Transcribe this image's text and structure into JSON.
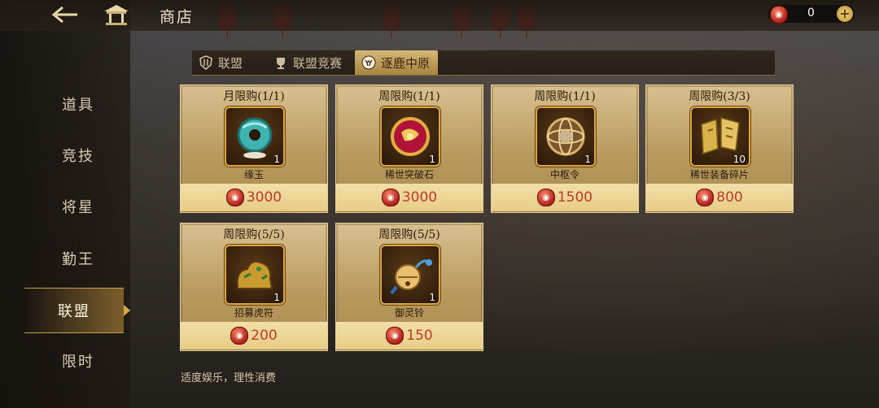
{
  "header": {
    "title": "商店",
    "currency_amount": "0",
    "plus_label": "+"
  },
  "sidebar": {
    "items": [
      {
        "label": "道具",
        "active": false
      },
      {
        "label": "竞技",
        "active": false
      },
      {
        "label": "将星",
        "active": false
      },
      {
        "label": "勤王",
        "active": false
      },
      {
        "label": "联盟",
        "active": true
      },
      {
        "label": "限时",
        "active": false
      }
    ]
  },
  "tabs": [
    {
      "label": "联盟",
      "icon": "shield-icon",
      "active": false
    },
    {
      "label": "联盟竞赛",
      "icon": "trophy-icon",
      "active": false
    },
    {
      "label": "逐鹿中原",
      "icon": "deer-icon",
      "active": true
    }
  ],
  "items": [
    {
      "limit": "月限购(1/1)",
      "name": "缘玉",
      "qty": "1",
      "price": "3000",
      "icon": "jade-pendant-icon"
    },
    {
      "limit": "周限购(1/1)",
      "name": "稀世突破石",
      "qty": "1",
      "price": "3000",
      "icon": "breakthrough-stone-icon"
    },
    {
      "limit": "周限购(1/1)",
      "name": "中枢令",
      "qty": "1",
      "price": "1500",
      "icon": "armillary-sphere-icon"
    },
    {
      "limit": "周限购(3/3)",
      "name": "稀世装备碎片",
      "qty": "10",
      "price": "800",
      "icon": "equipment-fragment-icon"
    },
    {
      "limit": "周限购(5/5)",
      "name": "招募虎符",
      "qty": "1",
      "price": "200",
      "icon": "tiger-tally-icon"
    },
    {
      "limit": "周限购(5/5)",
      "name": "御灵铃",
      "qty": "1",
      "price": "150",
      "icon": "spirit-bell-icon"
    }
  ],
  "footer_note": "适度娱乐，理性消费",
  "colors": {
    "accent_gold": "#d7a84a",
    "price_red": "#c0392b",
    "card_bg": "#c8ad72"
  }
}
